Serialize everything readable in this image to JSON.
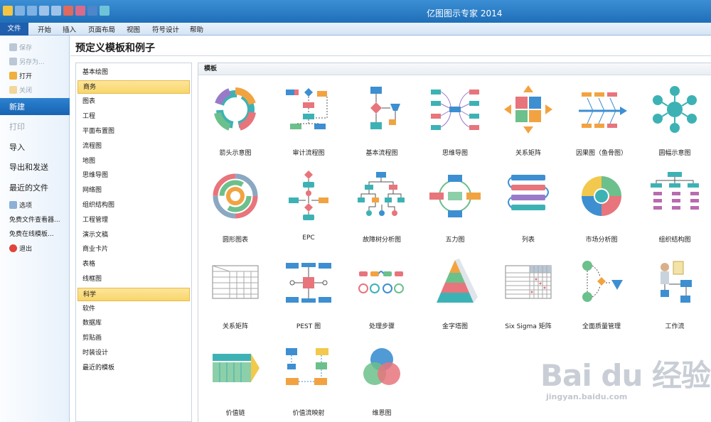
{
  "titlebar": {
    "title": "亿图图示专家 2014"
  },
  "menubar": {
    "tabs": [
      "文件",
      "开始",
      "插入",
      "页面布局",
      "视图",
      "符号设计",
      "帮助"
    ]
  },
  "sidebar": {
    "save": "保存",
    "save_as": "另存为...",
    "open": "打开",
    "close": "关闭",
    "new": "新建",
    "print": "打印",
    "import": "导入",
    "export_send": "导出和发送",
    "recent": "最近的文件",
    "options": "选项",
    "free_viewer": "免费文件查看器...",
    "free_templates": "免费在线模板...",
    "exit": "退出"
  },
  "main": {
    "heading": "预定义模板和例子",
    "templates_header": "模板"
  },
  "categories": [
    "基本绘图",
    "商务",
    "图表",
    "工程",
    "平面布置图",
    "流程图",
    "地图",
    "思维导图",
    "网络图",
    "组织结构图",
    "工程管理",
    "演示文稿",
    "商业卡片",
    "表格",
    "线框图",
    "科学",
    "软件",
    "数据库",
    "剪贴画",
    "时装设计",
    "最近的模板"
  ],
  "selected_categories": [
    "商务",
    "科学"
  ],
  "templates": [
    "箭头示意图",
    "审计流程图",
    "基本流程图",
    "思维导图",
    "关系矩阵",
    "因果图（鱼骨图）",
    "圆幅示意图",
    "圆形图表",
    "EPC",
    "故障树分析图",
    "五力图",
    "列表",
    "市场分析图",
    "组织结构图",
    "关系矩阵",
    "PEST 图",
    "处理步骤",
    "金字塔图",
    "Six Sigma 矩阵",
    "全面质量管理",
    "工作流",
    "价值链",
    "价值流映射",
    "维恩图"
  ],
  "watermark": {
    "brand": "Bai du 经验",
    "url": "jingyan.baidu.com"
  },
  "colors": {
    "accent": "#1f6fb8",
    "selected": "#f8d66b",
    "teal": "#3db2b5",
    "orange": "#f2a341",
    "red": "#e8747c",
    "green": "#6cc08b",
    "blue": "#3d8fd1"
  }
}
